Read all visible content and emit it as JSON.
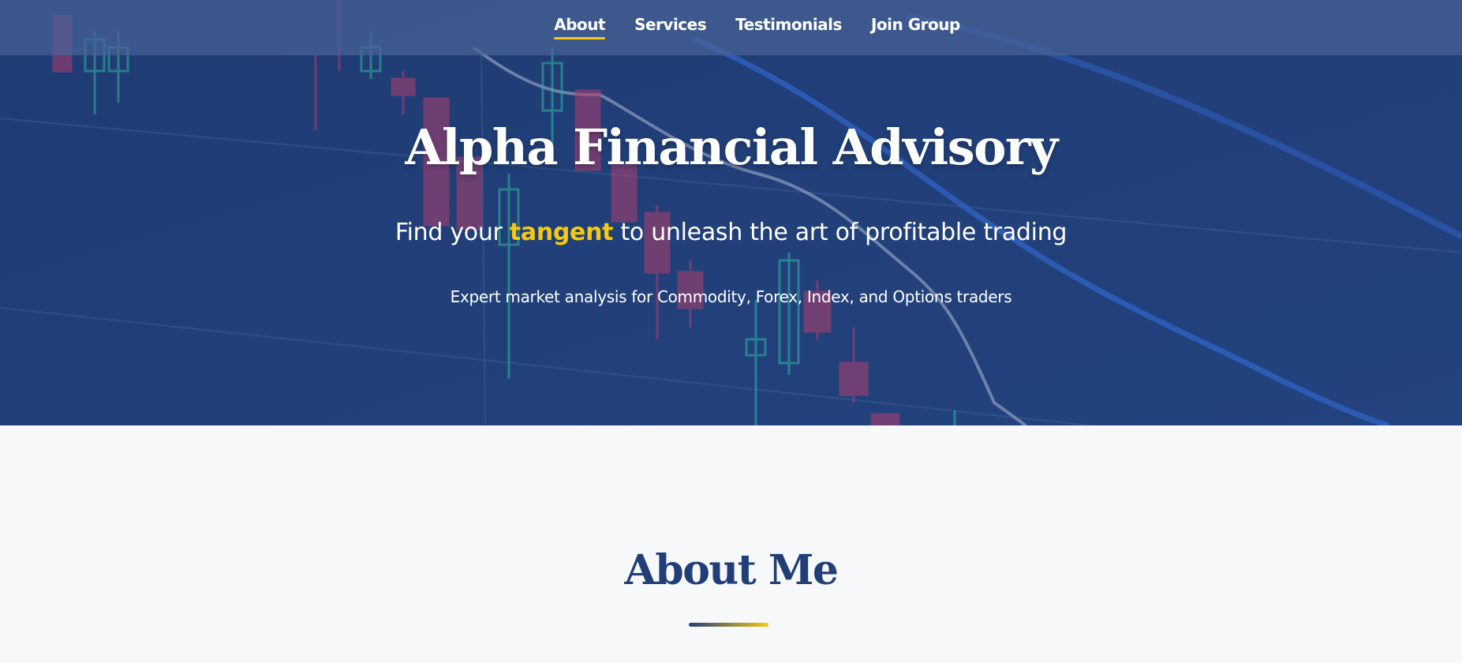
{
  "nav": {
    "items": [
      {
        "label": "About",
        "active": true
      },
      {
        "label": "Services",
        "active": false
      },
      {
        "label": "Testimonials",
        "active": false
      },
      {
        "label": "Join Group",
        "active": false
      }
    ]
  },
  "hero": {
    "title": "Alpha Financial Advisory",
    "tagline_before": "Find your",
    "tagline_accent": "tangent",
    "tagline_after": "to unleash the art of profitable trading",
    "subtitle": "Expert market analysis for Commodity, Forex, Index, and Options traders"
  },
  "about": {
    "title": "About Me"
  },
  "colors": {
    "primary": "#213e77",
    "accent": "#f6c90e",
    "navbar": "#48628f",
    "background": "#f7f8fa"
  }
}
